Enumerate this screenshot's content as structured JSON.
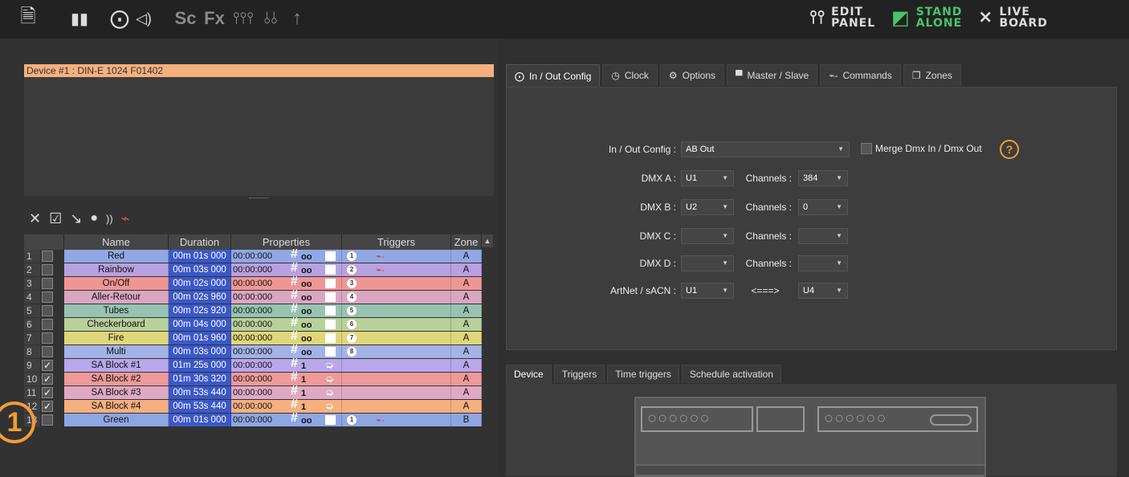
{
  "topbar": {
    "icons_left": [
      "save-icon",
      "bar-chart-icon",
      "dmx-connector-icon",
      "speaker-icon",
      "scene-icon",
      "effects-icon",
      "faders-icon",
      "mixer-icon",
      "upload-arrow-icon"
    ],
    "glyphs": {
      "save": "🗎",
      "bars": "▮▮",
      "dmx": "⨀",
      "sound": "◁)",
      "sc": "Sc",
      "fx": "Fx",
      "faders": "⫯⫯⫯",
      "mixer": "⫰⫰",
      "upload": "↑"
    },
    "edit_panel": [
      "EDIT",
      "PANEL"
    ],
    "stand_alone": [
      "STAND",
      "ALONE"
    ],
    "live_board": [
      "LIVE",
      "BOARD"
    ],
    "accent_green": "#49c46b"
  },
  "device": {
    "title": "Device #1 : DIN-E 1024 F01402",
    "header_color": "#f6b07d"
  },
  "toolbar": {
    "glyphs": [
      "✕",
      "☑",
      "↘",
      "●",
      "))",
      "⌁"
    ]
  },
  "table": {
    "headers": [
      "Name",
      "Duration",
      "Properties",
      "Triggers",
      "Zone"
    ],
    "rows": [
      {
        "num": "1",
        "checked": false,
        "name": "Red",
        "duration": "00m 01s 000",
        "time": "00:00:000",
        "hash": "oo",
        "action": "box",
        "trigger": "1",
        "cmd": true,
        "zone": "A",
        "color": "#92a8e2"
      },
      {
        "num": "2",
        "checked": false,
        "name": "Rainbow",
        "duration": "00m 03s 000",
        "time": "00:00:000",
        "hash": "oo",
        "action": "box",
        "trigger": "2",
        "cmd": true,
        "zone": "A",
        "color": "#b8a1e0"
      },
      {
        "num": "3",
        "checked": false,
        "name": "On/Off",
        "duration": "00m 02s 000",
        "time": "00:00:000",
        "hash": "oo",
        "action": "box",
        "trigger": "3",
        "cmd": false,
        "zone": "A",
        "color": "#ee9696"
      },
      {
        "num": "4",
        "checked": false,
        "name": "Aller-Retour",
        "duration": "00m 02s 960",
        "time": "00:00:000",
        "hash": "oo",
        "action": "box",
        "trigger": "4",
        "cmd": false,
        "zone": "A",
        "color": "#d9a7c0"
      },
      {
        "num": "5",
        "checked": false,
        "name": "Tubes",
        "duration": "00m 02s 920",
        "time": "00:00:000",
        "hash": "oo",
        "action": "box",
        "trigger": "5",
        "cmd": false,
        "zone": "A",
        "color": "#97c3b0"
      },
      {
        "num": "6",
        "checked": false,
        "name": "Checkerboard",
        "duration": "00m 04s 000",
        "time": "00:00:000",
        "hash": "oo",
        "action": "box",
        "trigger": "6",
        "cmd": false,
        "zone": "A",
        "color": "#b8d09a"
      },
      {
        "num": "7",
        "checked": false,
        "name": "Fire",
        "duration": "00m 01s 960",
        "time": "00:00:000",
        "hash": "oo",
        "action": "box",
        "trigger": "7",
        "cmd": false,
        "zone": "A",
        "color": "#e0d67a"
      },
      {
        "num": "8",
        "checked": false,
        "name": "Multi",
        "duration": "00m 03s 000",
        "time": "00:00:000",
        "hash": "oo",
        "action": "box",
        "trigger": "8",
        "cmd": false,
        "zone": "A",
        "color": "#a3b3e6"
      },
      {
        "num": "9",
        "checked": true,
        "name": "SA Block #1",
        "duration": "01m 25s 000",
        "time": "00:00:000",
        "hash": "1",
        "action": "arrow",
        "trigger": "",
        "cmd": false,
        "zone": "A",
        "color": "#b9a7ea"
      },
      {
        "num": "10",
        "checked": true,
        "name": "SA Block #2",
        "duration": "01m 30s 320",
        "time": "00:00:000",
        "hash": "1",
        "action": "arrow",
        "trigger": "",
        "cmd": false,
        "zone": "A",
        "color": "#ee9a9a"
      },
      {
        "num": "11",
        "checked": true,
        "name": "SA Block #3",
        "duration": "00m 53s 440",
        "time": "00:00:000",
        "hash": "1",
        "action": "arrow",
        "trigger": "",
        "cmd": false,
        "zone": "A",
        "color": "#dfa9c4"
      },
      {
        "num": "12",
        "checked": true,
        "name": "SA Block #4",
        "duration": "00m 53s 440",
        "time": "00:00:000",
        "hash": "1",
        "action": "arrow",
        "trigger": "",
        "cmd": false,
        "zone": "A",
        "color": "#f4b07f"
      },
      {
        "num": "13",
        "checked": false,
        "name": "Green",
        "duration": "00m 01s 000",
        "time": "00:00:000",
        "hash": "oo",
        "action": "box",
        "trigger": "1",
        "cmd": true,
        "zone": "B",
        "color": "#8fa6e4"
      }
    ]
  },
  "badge": "1",
  "tabs_top": [
    {
      "label": "In / Out Config",
      "icon": "dmx-icon",
      "glyph": "⨀",
      "active": true
    },
    {
      "label": "Clock",
      "icon": "clock-icon",
      "glyph": "◷",
      "active": false
    },
    {
      "label": "Options",
      "icon": "gear-icon",
      "glyph": "⚙",
      "active": false
    },
    {
      "label": "Master / Slave",
      "icon": "master-slave-icon",
      "glyph": "▀",
      "active": false
    },
    {
      "label": "Commands",
      "icon": "commands-icon",
      "glyph": "⌁-",
      "active": false
    },
    {
      "label": "Zones",
      "icon": "zones-icon",
      "glyph": "❐",
      "active": false
    }
  ],
  "config": {
    "inout_label": "In / Out Config :",
    "inout_value": "AB Out",
    "merge_label": "Merge Dmx In / Dmx Out",
    "help": "?",
    "dmx_a_label": "DMX A :",
    "dmx_a": "U1",
    "dmx_b_label": "DMX B :",
    "dmx_b": "U2",
    "dmx_c_label": "DMX C :",
    "dmx_c": "",
    "dmx_d_label": "DMX D :",
    "dmx_d": "",
    "channels_label": "Channels :",
    "ch_a": "384",
    "ch_b": "0",
    "ch_c": "",
    "ch_d": "",
    "artnet_label": "ArtNet / sACN :",
    "artnet_in": "U1",
    "arrow_text": "<===>",
    "artnet_out": "U4",
    "caret": "▼"
  },
  "tabs_bottom": [
    {
      "label": "Device",
      "active": true
    },
    {
      "label": "Triggers",
      "active": false
    },
    {
      "label": "Time triggers",
      "active": false
    },
    {
      "label": "Schedule activation",
      "active": false
    }
  ],
  "device_view": {
    "dots_left": "○○○○○○",
    "dots_right": "○○○○○○"
  }
}
